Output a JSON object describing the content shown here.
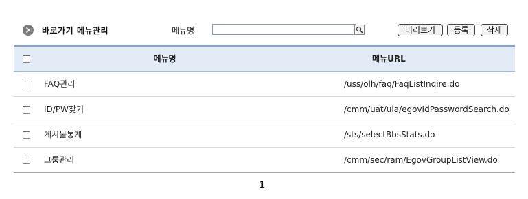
{
  "header": {
    "title": "바로가기 메뉴관리",
    "search_label": "메뉴명",
    "search_value": "",
    "search_placeholder": "",
    "buttons": {
      "preview": "미리보기",
      "register": "등록",
      "delete": "삭제"
    }
  },
  "table": {
    "columns": [
      "",
      "메뉴명",
      "메뉴URL"
    ],
    "rows": [
      {
        "name": "FAQ관리",
        "url": "/uss/olh/faq/FaqListInqire.do"
      },
      {
        "name": "ID/PW찾기",
        "url": "/cmm/uat/uia/egovIdPasswordSearch.do"
      },
      {
        "name": "게시물통계",
        "url": "/sts/selectBbsStats.do"
      },
      {
        "name": "그룹관리",
        "url": "/cmm/sec/ram/EgovGroupListView.do"
      }
    ]
  },
  "pagination": {
    "current_page": "1"
  },
  "colors": {
    "header_bg": "#e3ebf7",
    "header_border": "#7aa5d6",
    "title_icon": "#7c7c7c"
  },
  "icons": {
    "title": "arrow-circle-icon",
    "search": "magnifier-icon"
  }
}
